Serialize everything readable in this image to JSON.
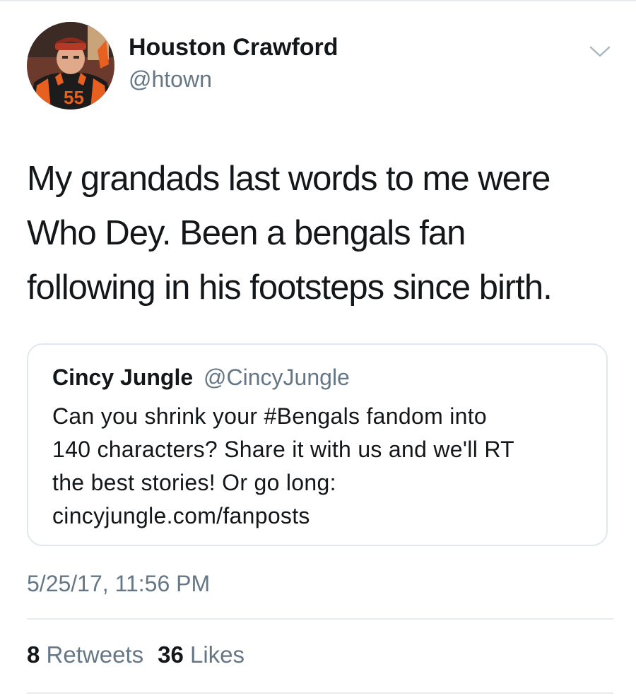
{
  "author": {
    "display_name": "Houston Crawford",
    "handle": "@htown",
    "avatar_jersey_number": "55"
  },
  "tweet": {
    "text_lines": [
      "My grandads last words to me were",
      "Who Dey. Been a bengals fan",
      "following in his footsteps since birth."
    ],
    "timestamp": "5/25/17, 11:56 PM"
  },
  "quoted_tweet": {
    "display_name": "Cincy Jungle",
    "handle": "@CincyJungle",
    "text_lines": [
      "Can you shrink your #Bengals fandom into",
      "140 characters? Share it with us and we'll RT",
      "the best stories! Or go long:",
      "cincyjungle.com/fanposts"
    ]
  },
  "stats": {
    "retweets_count": "8",
    "retweets_label": "Retweets",
    "likes_count": "36",
    "likes_label": "Likes"
  },
  "icons": {
    "menu": "chevron-down-icon"
  },
  "colors": {
    "text_primary": "#14171a",
    "text_secondary": "#657786",
    "border": "#e1e8ed",
    "jersey_orange": "#e8601f"
  }
}
